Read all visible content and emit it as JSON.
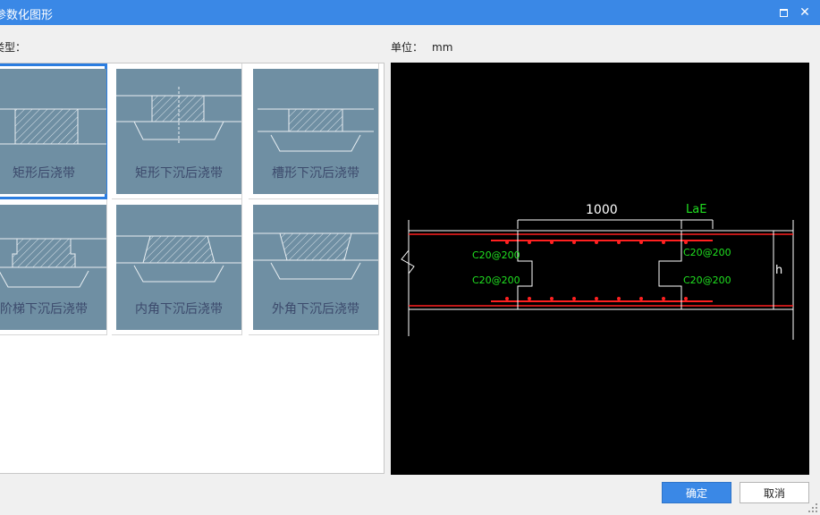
{
  "window": {
    "title": "参数化图形"
  },
  "type_label": "类型：",
  "unit": {
    "label": "单位：",
    "value": "mm"
  },
  "grid": {
    "items": [
      {
        "label": "矩形后浇带"
      },
      {
        "label": "矩形下沉后浇带"
      },
      {
        "label": "槽形下沉后浇带"
      },
      {
        "label": "阶梯下沉后浇带"
      },
      {
        "label": "内角下沉后浇带"
      },
      {
        "label": "外角下沉后浇带"
      }
    ],
    "selected_index": 0
  },
  "preview": {
    "dim_width": "1000",
    "dim_lae": "LaE",
    "rebar_top_left": "C20@200",
    "rebar_bottom_left": "C20@200",
    "rebar_top_right": "C20@200",
    "rebar_bottom_right": "C20@200",
    "height_label": "h"
  },
  "buttons": {
    "ok": "确定",
    "cancel": "取消"
  },
  "colors": {
    "accent": "#3a88e6",
    "thumb_bg": "#6f8fa3",
    "rebar": "#ff2020",
    "annotation": "#20e020"
  }
}
